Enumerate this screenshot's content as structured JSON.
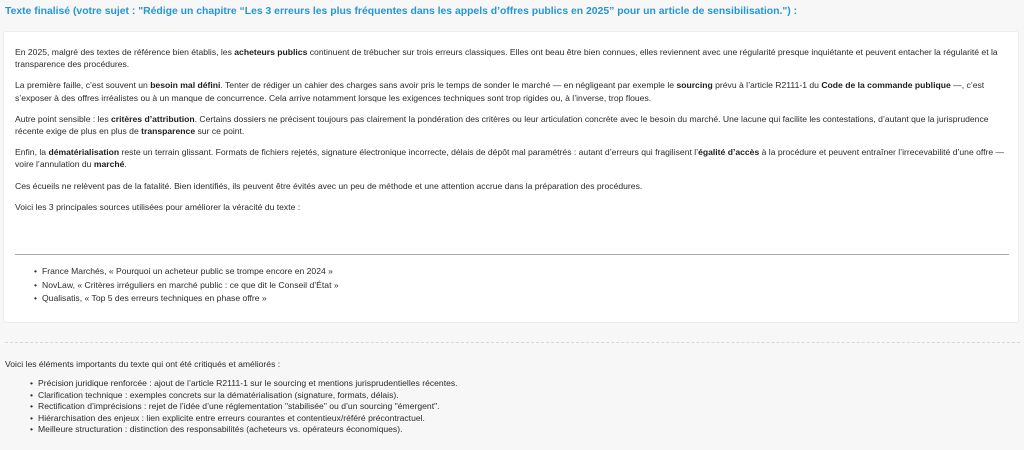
{
  "heading": "Texte finalisé (votre sujet : \"Rédige un chapitre “Les 3 erreurs les plus fréquentes dans les appels d’offres publics en 2025” pour un article de sensibilisation.\") :",
  "article": {
    "p1": {
      "a": "En 2025, malgré des textes de référence bien établis, les ",
      "b1": "acheteurs publics",
      "c": " continuent de trébucher sur trois erreurs classiques. Elles ont beau être bien connues, elles reviennent avec une régularité presque inquiétante et peuvent entacher la régularité et la transparence des procédures."
    },
    "p2": {
      "a": "La première faille, c’est souvent un ",
      "b1": "besoin mal défini",
      "c": ". Tenter de rédiger un cahier des charges sans avoir pris le temps de sonder le marché — en négligeant par exemple le ",
      "b2": "sourcing",
      "d": " prévu à l’article R2111-1 du ",
      "b3": "Code de la commande publique",
      "e": " —, c’est s’exposer à des offres irréalistes ou à un manque de concurrence. Cela arrive notamment lorsque les exigences techniques sont trop rigides ou, à l’inverse, trop floues."
    },
    "p3": {
      "a": "Autre point sensible : les ",
      "b1": "critères d’attribution",
      "c": ". Certains dossiers ne précisent toujours pas clairement la pondération des critères ou leur articulation concrète avec le besoin du marché. Une lacune qui facilite les contestations, d’autant que la jurisprudence récente exige de plus en plus de ",
      "b2": "transparence",
      "d": " sur ce point."
    },
    "p4": {
      "a": "Enfin, la ",
      "b1": "dématérialisation",
      "c": " reste un terrain glissant. Formats de fichiers rejetés, signature électronique incorrecte, délais de dépôt mal paramétrés : autant d’erreurs qui fragilisent l’",
      "b2": "égalité d’accès",
      "d": " à la procédure et peuvent entraîner l’irrecevabilité d’une offre — voire l’annulation du ",
      "b3": "marché",
      "e": "."
    },
    "p5": "Ces écueils ne relèvent pas de la fatalité. Bien identifiés, ils peuvent être évités avec un peu de méthode et une attention accrue dans la préparation des procédures.",
    "p6": "Voici les 3 principales sources utilisées pour améliorer la véracité du texte :"
  },
  "sources": [
    "France Marchés, « Pourquoi un acheteur public se trompe encore en 2024 »",
    "NovLaw, « Critères irréguliers en marché public : ce que dit le Conseil d’État »",
    "Qualisatis, « Top 5 des erreurs techniques en phase offre »"
  ],
  "improvements_intro": "Voici les éléments importants du texte qui ont été critiqués et améliorés :",
  "improvements": [
    "Précision juridique renforcée : ajout de l’article R2111-1 sur le sourcing et mentions jurisprudentielles récentes.",
    "Clarification technique : exemples concrets sur la dématérialisation (signature, formats, délais).",
    "Rectification d’imprécisions : rejet de l’idée d’une réglementation \"stabilisée\" ou d’un sourcing \"émergent\".",
    "Hiérarchisation des enjeux : lien explicite entre erreurs courantes et contentieux/référé précontractuel.",
    "Meilleure structuration : distinction des responsabilités (acheteurs vs. opérateurs économiques)."
  ],
  "colors": {
    "heading": "#2596d4",
    "text": "#2b2b2b",
    "card": "#ffffff",
    "background": "#f7f7f8"
  }
}
